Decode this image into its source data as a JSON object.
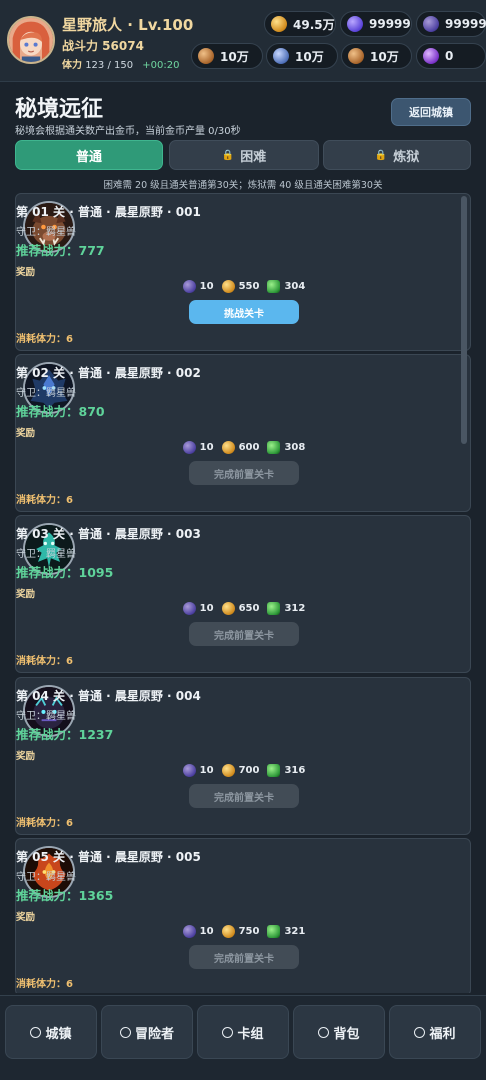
{
  "player": {
    "name": "星野旅人 · Lv.100",
    "power": "战斗力 56074",
    "stamina_label": "体力",
    "stamina_value": "123 / 150",
    "stamina_timer": "+00:20"
  },
  "currencies": [
    {
      "icon": "gold-coin-icon",
      "value": "49.5万"
    },
    {
      "icon": "blue-gem-icon",
      "value": "99999"
    },
    {
      "icon": "purple-gem-icon",
      "value": "99999"
    },
    {
      "icon": "bronze-medal-icon",
      "value": "10万"
    },
    {
      "icon": "steel-gear-icon",
      "value": "10万"
    },
    {
      "icon": "copper-coin-icon",
      "value": "10万"
    },
    {
      "icon": "violet-orb-icon",
      "value": "0"
    }
  ],
  "page": {
    "title": "秘境远征",
    "subtitle": "秘境会根据通关数产出金币，当前金币产量 0/30秒",
    "back_label": "返回城镇",
    "unlock_note": "困难需 20 级且通关普通第30关；炼狱需 40 级且通关困难第30关"
  },
  "tabs": [
    {
      "label": "普通",
      "active": true,
      "locked": false
    },
    {
      "label": "困难",
      "active": false,
      "locked": true
    },
    {
      "label": "炼狱",
      "active": false,
      "locked": true
    }
  ],
  "stages": [
    {
      "title": "第 01 关 · 普通 · 晨星原野 · 001",
      "guard": "守卫：羁星兽",
      "power_label": "推荐战力：",
      "power": "777",
      "reward_label": "奖励",
      "rewards": [
        "10",
        "550",
        "304"
      ],
      "button": "挑战关卡",
      "button_active": true,
      "cost": "消耗体力：6",
      "boss": "boar-beast-icon"
    },
    {
      "title": "第 02 关 · 普通 · 晨星原野 · 002",
      "guard": "守卫：羁星兽",
      "power_label": "推荐战力：",
      "power": "870",
      "reward_label": "奖励",
      "rewards": [
        "10",
        "600",
        "308"
      ],
      "button": "完成前置关卡",
      "button_active": false,
      "cost": "消耗体力：6",
      "boss": "dark-crystal-beast-icon"
    },
    {
      "title": "第 03 关 · 普通 · 晨星原野 · 003",
      "guard": "守卫：羁星兽",
      "power_label": "推荐战力：",
      "power": "1095",
      "reward_label": "奖励",
      "rewards": [
        "10",
        "650",
        "312"
      ],
      "button": "完成前置关卡",
      "button_active": false,
      "cost": "消耗体力：6",
      "boss": "teal-spirit-icon"
    },
    {
      "title": "第 04 关 · 普通 · 晨星原野 · 004",
      "guard": "守卫：羁星兽",
      "power_label": "推荐战力：",
      "power": "1237",
      "reward_label": "奖励",
      "rewards": [
        "10",
        "700",
        "316"
      ],
      "button": "完成前置关卡",
      "button_active": false,
      "cost": "消耗体力：6",
      "boss": "shadow-golem-icon"
    },
    {
      "title": "第 05 关 · 普通 · 晨星原野 · 005",
      "guard": "守卫：羁星兽",
      "power_label": "推荐战力：",
      "power": "1365",
      "reward_label": "奖励",
      "rewards": [
        "10",
        "750",
        "321"
      ],
      "button": "完成前置关卡",
      "button_active": false,
      "cost": "消耗体力：6",
      "boss": "flame-demon-icon"
    }
  ],
  "nav": [
    {
      "label": "城镇"
    },
    {
      "label": "冒险者"
    },
    {
      "label": "卡组"
    },
    {
      "label": "背包"
    },
    {
      "label": "福利"
    }
  ],
  "colors": {
    "accent_green": "#2f9a78",
    "power_green": "#5fd39a",
    "challenge_blue": "#5bb7ee",
    "gold_text": "#f0d7a0"
  }
}
